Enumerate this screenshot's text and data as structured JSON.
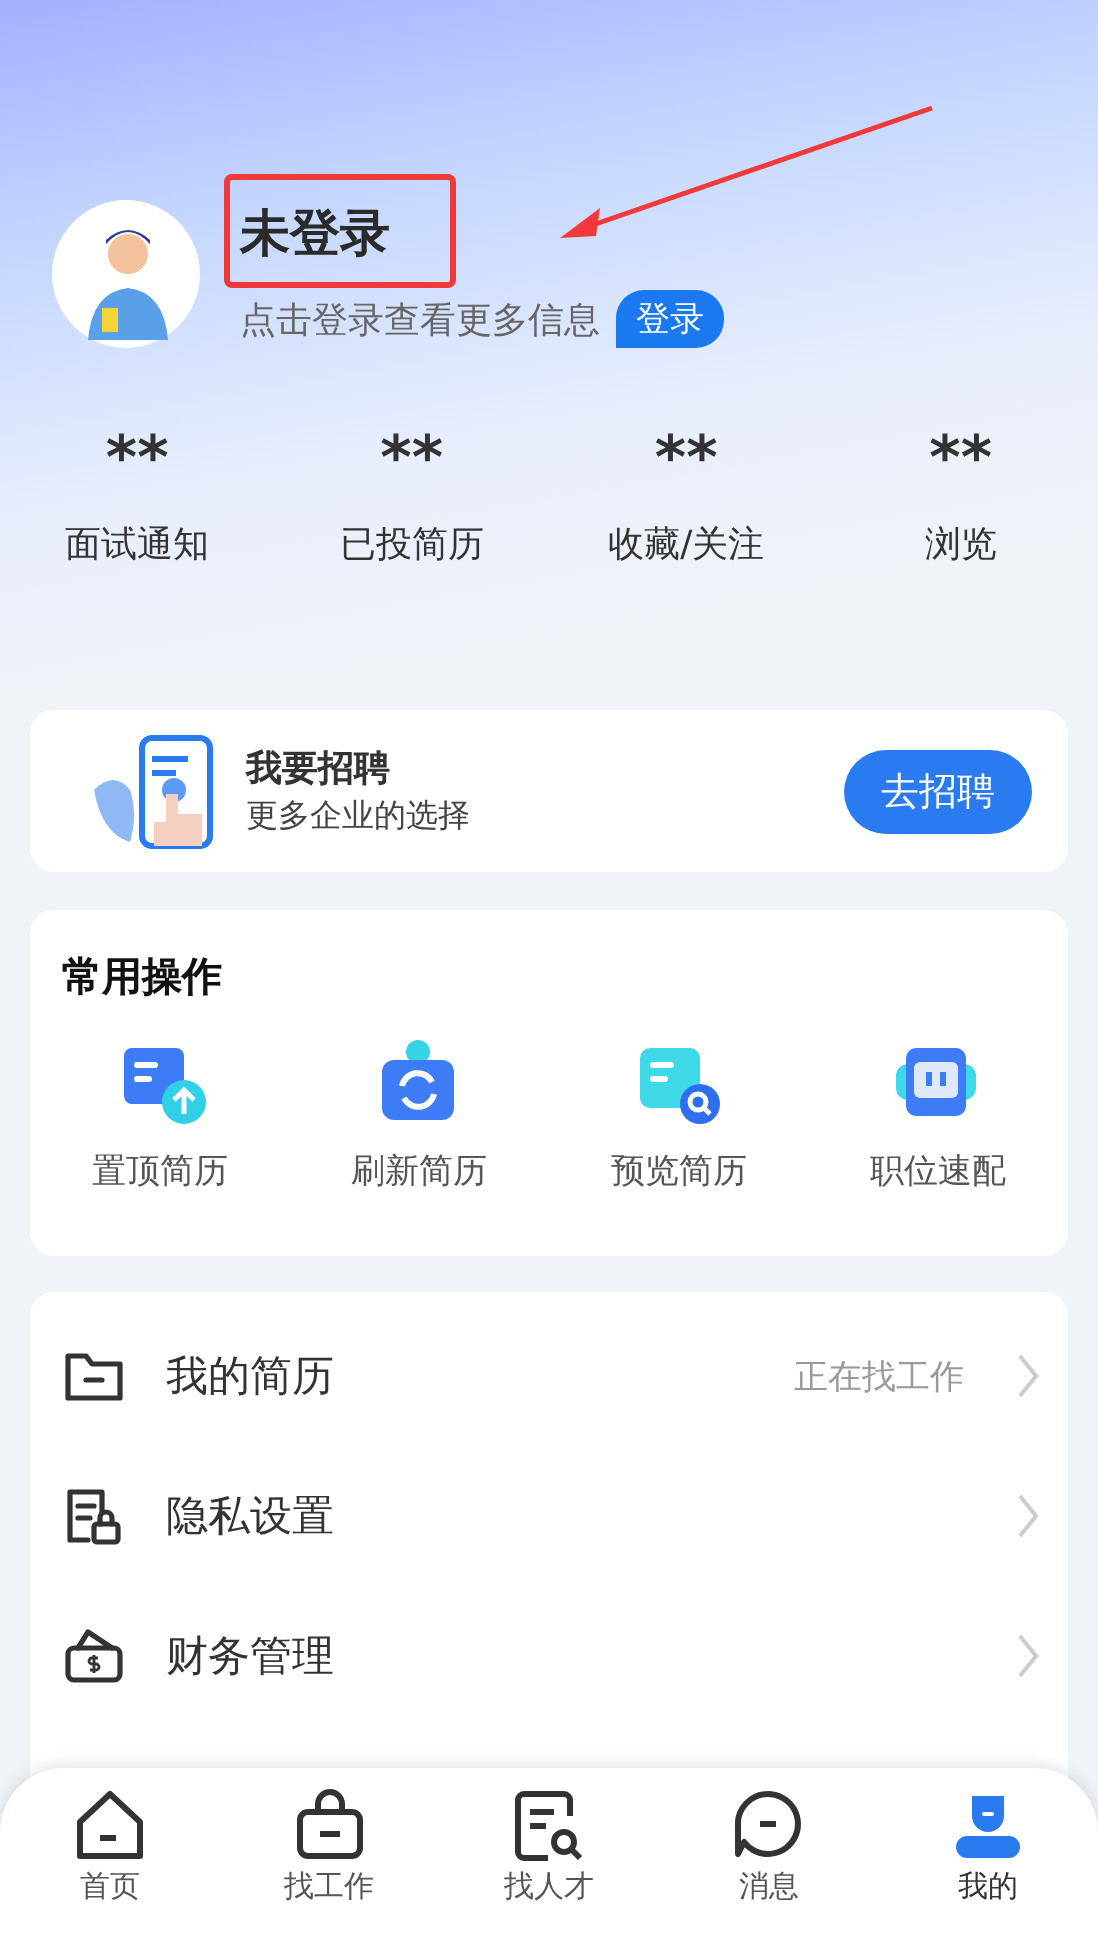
{
  "profile": {
    "name": "未登录",
    "hint": "点击登录查看更多信息",
    "login_button": "登录"
  },
  "stats": [
    {
      "value": "**",
      "label": "面试通知"
    },
    {
      "value": "**",
      "label": "已投简历"
    },
    {
      "value": "**",
      "label": "收藏/关注"
    },
    {
      "value": "**",
      "label": "浏览"
    }
  ],
  "recruit_card": {
    "title": "我要招聘",
    "subtitle": "更多企业的选择",
    "button": "去招聘"
  },
  "common_actions": {
    "title": "常用操作",
    "items": [
      {
        "kind": "pin",
        "label": "置顶简历"
      },
      {
        "kind": "refresh",
        "label": "刷新简历"
      },
      {
        "kind": "preview",
        "label": "预览简历"
      },
      {
        "kind": "match",
        "label": "职位速配"
      }
    ]
  },
  "menu": [
    {
      "kind": "resume",
      "label": "我的简历",
      "value": "正在找工作"
    },
    {
      "kind": "privacy",
      "label": "隐私设置"
    },
    {
      "kind": "finance",
      "label": "财务管理"
    }
  ],
  "tab_bar": [
    {
      "kind": "home",
      "label": "首页",
      "selected": false
    },
    {
      "kind": "jobs",
      "label": "找工作",
      "selected": false
    },
    {
      "kind": "talent",
      "label": "找人才",
      "selected": false
    },
    {
      "kind": "messages",
      "label": "消息",
      "selected": false
    },
    {
      "kind": "me",
      "label": "我的",
      "selected": true
    }
  ]
}
